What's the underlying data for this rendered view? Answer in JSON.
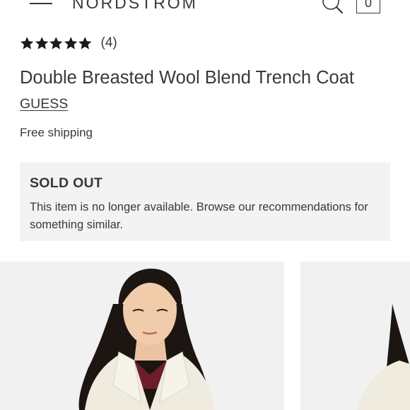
{
  "header": {
    "brand": "NORDSTROM",
    "menu_icon": "hamburger-menu-icon",
    "search_icon": "search-icon",
    "bag_icon": "shopping-bag-icon",
    "bag_count": "0"
  },
  "product": {
    "rating": {
      "stars": 5,
      "count_label": "(4)"
    },
    "title": "Double Breasted Wool Blend Trench Coat",
    "brand": "GUESS",
    "shipping": "Free shipping"
  },
  "availability": {
    "status": "SOLD OUT",
    "message": "This item is no longer available. Browse our recommendations for something similar."
  },
  "colors": {
    "text": "#393939",
    "panel": "#f3f3f3",
    "photo_bg": "#f1f1f1",
    "coat": "#efecdf",
    "collar": "#6d1e2a",
    "hair": "#1c1512"
  }
}
